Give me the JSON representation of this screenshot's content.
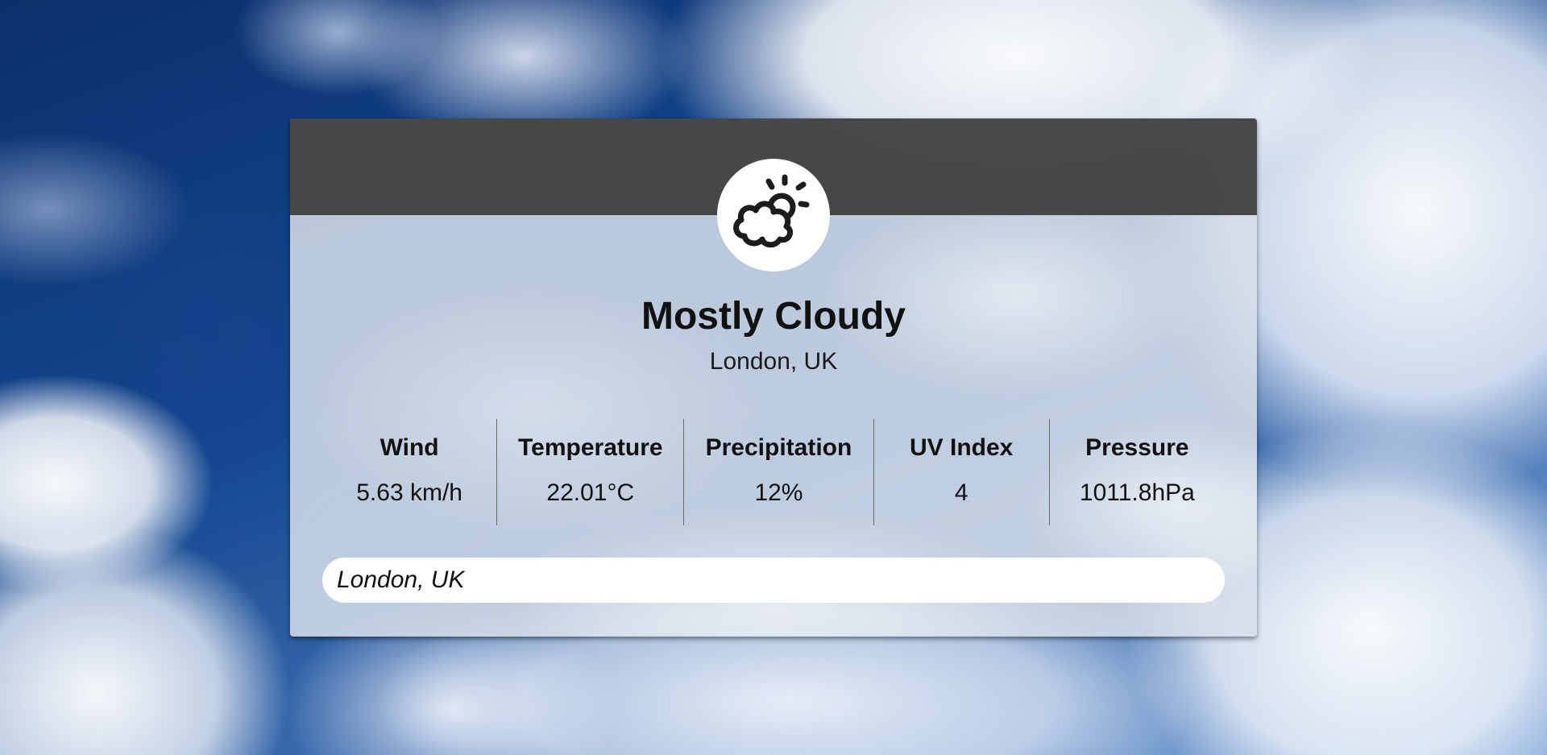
{
  "weather": {
    "icon": "partly-cloudy-icon",
    "condition": "Mostly Cloudy",
    "location": "London, UK"
  },
  "stats": [
    {
      "label": "Wind",
      "value": "5.63 km/h"
    },
    {
      "label": "Temperature",
      "value": "22.01°C"
    },
    {
      "label": "Precipitation",
      "value": "12%"
    },
    {
      "label": "UV Index",
      "value": "4"
    },
    {
      "label": "Pressure",
      "value": "1011.8hPa"
    }
  ],
  "search": {
    "value": "London, UK"
  },
  "colors": {
    "header": "#3c3c3c",
    "text": "#111111",
    "card": "#d6dee9",
    "icon_bg": "#ffffff"
  }
}
